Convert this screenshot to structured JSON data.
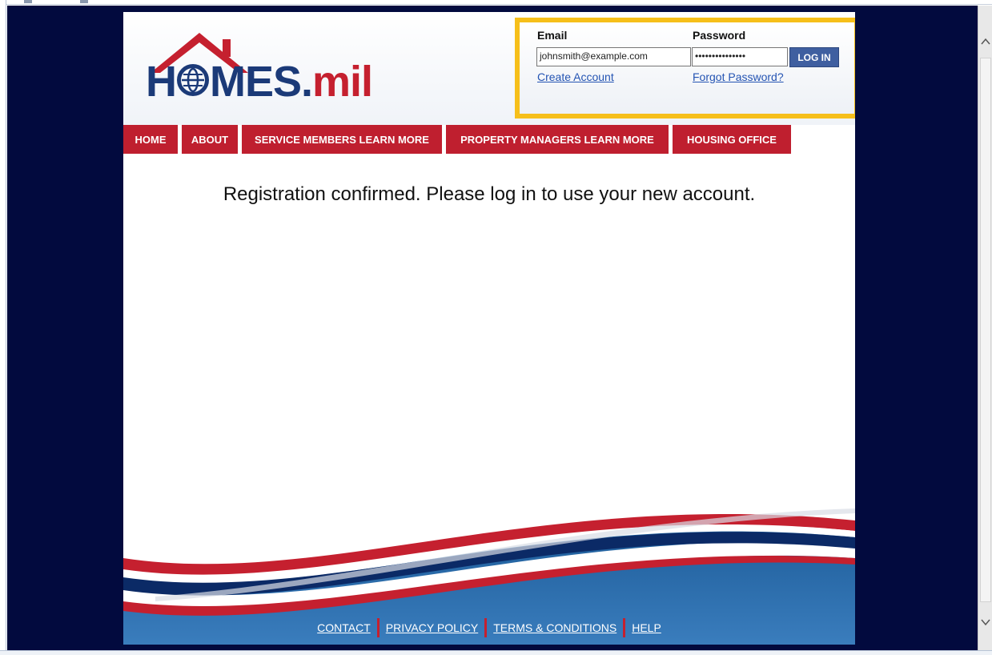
{
  "header": {
    "logo_text_pre": "H",
    "logo_text_post": "MES.",
    "logo_text_mil": "mil"
  },
  "login": {
    "email_label": "Email",
    "password_label": "Password",
    "email_value": "johnsmith@example.com",
    "password_value": "•••••••••••••••",
    "login_button": "LOG IN",
    "create_account": "Create Account",
    "forgot_password": "Forgot Password?"
  },
  "nav": {
    "items": [
      {
        "label": "HOME"
      },
      {
        "label": "ABOUT"
      },
      {
        "label": "SERVICE MEMBERS LEARN MORE"
      },
      {
        "label": "PROPERTY MANAGERS LEARN MORE"
      },
      {
        "label": "HOUSING OFFICE"
      }
    ]
  },
  "main": {
    "message": "Registration confirmed. Please log in to use your new account."
  },
  "footer": {
    "links": [
      {
        "label": "CONTACT"
      },
      {
        "label": "PRIVACY POLICY"
      },
      {
        "label": "TERMS & CONDITIONS"
      },
      {
        "label": "HELP"
      }
    ]
  },
  "colors": {
    "brand_blue": "#1b3a78",
    "brand_red": "#c5202f",
    "nav_red": "#bf1f2f",
    "highlight_yellow": "#f6bf1a",
    "page_background": "#020a3e",
    "button_blue": "#3f5fa0"
  },
  "scrollbar": {
    "up_icon": "chevron-up-icon",
    "down_icon": "chevron-down-icon"
  }
}
